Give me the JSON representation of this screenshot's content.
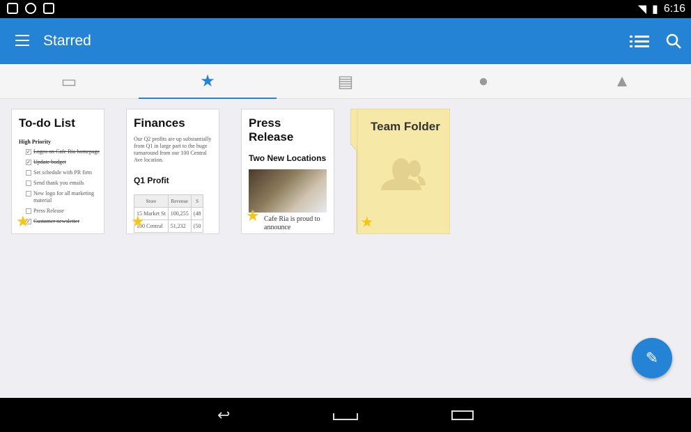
{
  "status": {
    "time": "6:16"
  },
  "appbar": {
    "title": "Starred"
  },
  "tabs": [
    {
      "icon": "inbox-icon"
    },
    {
      "icon": "star-icon",
      "active": true
    },
    {
      "icon": "documents-icon"
    },
    {
      "icon": "chat-icon"
    },
    {
      "icon": "bell-icon"
    }
  ],
  "cards": {
    "todo": {
      "title": "To-do List",
      "section": "High Priority",
      "items": [
        {
          "text": "Logos on Cafe Ria homepage",
          "done": true
        },
        {
          "text": "Update budget",
          "done": true
        },
        {
          "text": "Set schedule with PR firm",
          "done": false
        },
        {
          "text": "Send thank you emails",
          "done": false
        },
        {
          "text": "New logo for all marketing material",
          "done": false
        },
        {
          "text": "Press Release",
          "done": false
        },
        {
          "text": "Customer newsletter",
          "done": true
        }
      ]
    },
    "finances": {
      "title": "Finances",
      "body": "Our Q2 profits are up substantially from Q1 in large part to the huge turnaround from our 100 Central Ave location.",
      "subtitle": "Q1 Profit",
      "headers": [
        "Store",
        "Revenue",
        "S"
      ],
      "rows": [
        [
          "15 Market St",
          "100,255",
          "(48"
        ],
        [
          "100 Central",
          "51,232",
          "(50"
        ]
      ]
    },
    "press": {
      "title": "Press Release",
      "subtitle": "Two New Locations",
      "body": "Cafe Ria is proud to announce"
    },
    "folder": {
      "title": "Team Folder"
    }
  },
  "accent": "#2483d5",
  "star_color": "#f7c513"
}
